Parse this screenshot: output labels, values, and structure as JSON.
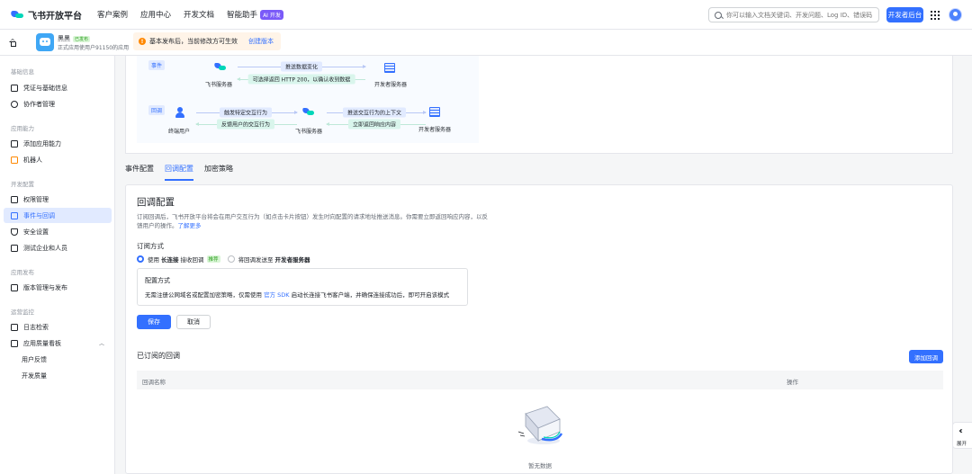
{
  "topnav": {
    "logo_text": "飞书开放平台",
    "links": [
      "客户案例",
      "应用中心",
      "开发文档",
      "智能助手"
    ],
    "ai_badge": "AI 开发",
    "search_placeholder": "你可以输入文档关键词、开发问题、Log ID、错误码",
    "dev_console": "开发者后台"
  },
  "appbar": {
    "app_name": "黑黑",
    "app_status": "已发布",
    "app_sub": "正式应用使用户91150的应用",
    "notice": "基本发布后，当前修改方可生效",
    "notice_link": "创建版本"
  },
  "sidebar": {
    "groups": [
      "基础信息",
      "应用能力",
      "开发配置",
      "应用发布",
      "运营监控"
    ],
    "items": [
      {
        "label": "凭证与基础信息"
      },
      {
        "label": "协作者管理"
      },
      {
        "label": "添加应用能力"
      },
      {
        "label": "机器人"
      },
      {
        "label": "权限管理"
      },
      {
        "label": "事件与回调"
      },
      {
        "label": "安全设置"
      },
      {
        "label": "测试企业和人员"
      },
      {
        "label": "版本管理与发布"
      },
      {
        "label": "日志检索"
      },
      {
        "label": "应用质量看板"
      },
      {
        "label": "用户反馈"
      },
      {
        "label": "开发质量"
      }
    ]
  },
  "diagram": {
    "event_tag": "事件",
    "callback_tag": "回调",
    "feishu_server": "飞书服务器",
    "dev_server": "开发者服务器",
    "end_user": "终端用户",
    "push_data": "推送数据变化",
    "return_200": "可选择返回 HTTP 200，以确认收到数据",
    "trigger": "触发特定交互行为",
    "feedback": "反馈用户的交互行为",
    "push_context": "推送交互行为的上下文",
    "respond": "立即返回响应内容"
  },
  "tabs": [
    "事件配置",
    "回调配置",
    "加密策略"
  ],
  "main": {
    "title": "回调配置",
    "desc": "订阅回调后，飞书开放平台将会在用户交互行为（如点击卡片按钮）发生时向配置的请求地址推送消息。你需要立即返回响应内容，以反馈用户的操作。",
    "desc_link": "了解更多",
    "sub_label": "订阅方式",
    "opt1_prefix": "使用",
    "opt1_bold": "长连接",
    "opt1_suffix": "接收回调",
    "opt1_badge": "推荐",
    "opt2_prefix": "将回调发送至",
    "opt2_bold": "开发者服务器",
    "cfg_title": "配置方式",
    "cfg_text_a": "无需注册公网域名或配置加密策略，仅需使用",
    "cfg_link": "官方 SDK",
    "cfg_text_b": "启动长连接飞书客户端，并确保连接成功后，即可开启该模式",
    "save": "保存",
    "cancel": "取消",
    "subscribed_title": "已订阅的回调",
    "add_callback": "添加回调",
    "col_name": "回调名称",
    "col_action": "操作",
    "empty": "暂无数据"
  },
  "collapse": {
    "label": "展开"
  }
}
